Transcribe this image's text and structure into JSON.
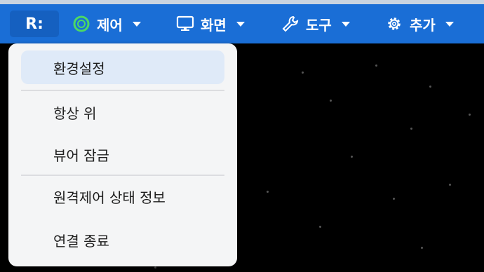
{
  "toolbar": {
    "logo_text": "R:",
    "items": [
      {
        "label": "제어",
        "icon": "remote-control-icon"
      },
      {
        "label": "화면",
        "icon": "monitor-icon"
      },
      {
        "label": "도구",
        "icon": "wrench-icon"
      },
      {
        "label": "추가",
        "icon": "gear-icon"
      }
    ]
  },
  "menu": {
    "items": [
      {
        "label": "환경설정"
      },
      {
        "label": "항상 위"
      },
      {
        "label": "뷰어 잠금"
      },
      {
        "label": "원격제어 상태 정보"
      },
      {
        "label": "연결 종료"
      }
    ]
  },
  "colors": {
    "toolbar_bg": "#1a6ed6",
    "menu_bg": "#f4f5f6",
    "highlight_bg": "#dfeaf8",
    "viewer_bg": "#000000",
    "control_icon_green": "#4cd964"
  }
}
